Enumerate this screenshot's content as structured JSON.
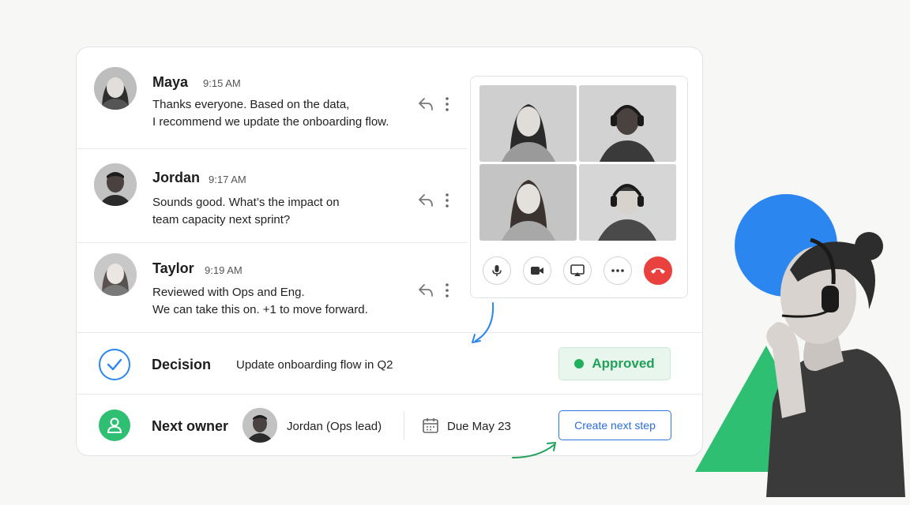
{
  "messages": [
    {
      "name": "Maya",
      "time": "9:15 AM",
      "line1": "Thanks everyone. Based on the data,",
      "line2": "I recommend we update the onboarding flow."
    },
    {
      "name": "Jordan",
      "time": "9:17 AM",
      "line1": "Sounds good. What’s the impact on",
      "line2": "team capacity next sprint?"
    },
    {
      "name": "Taylor",
      "time": "9:19 AM",
      "line1": "Reviewed with Ops and Eng.",
      "line2": "We can take this on. +1 to move forward."
    }
  ],
  "video_call": {
    "controls": [
      "microphone-icon",
      "camera-icon",
      "screen-share-icon",
      "more-icon",
      "end-call-icon"
    ]
  },
  "decision": {
    "label": "Decision",
    "text": "Update onboarding flow in Q2",
    "status": "Approved",
    "status_color": "#22a05a"
  },
  "next_owner": {
    "label": "Next owner",
    "owner": "Jordan (Ops lead)",
    "due": "Due May 23",
    "button": "Create next step"
  },
  "colors": {
    "accent_blue": "#2b86f0",
    "accent_green": "#2fbf72",
    "end_call_red": "#e9423e"
  }
}
